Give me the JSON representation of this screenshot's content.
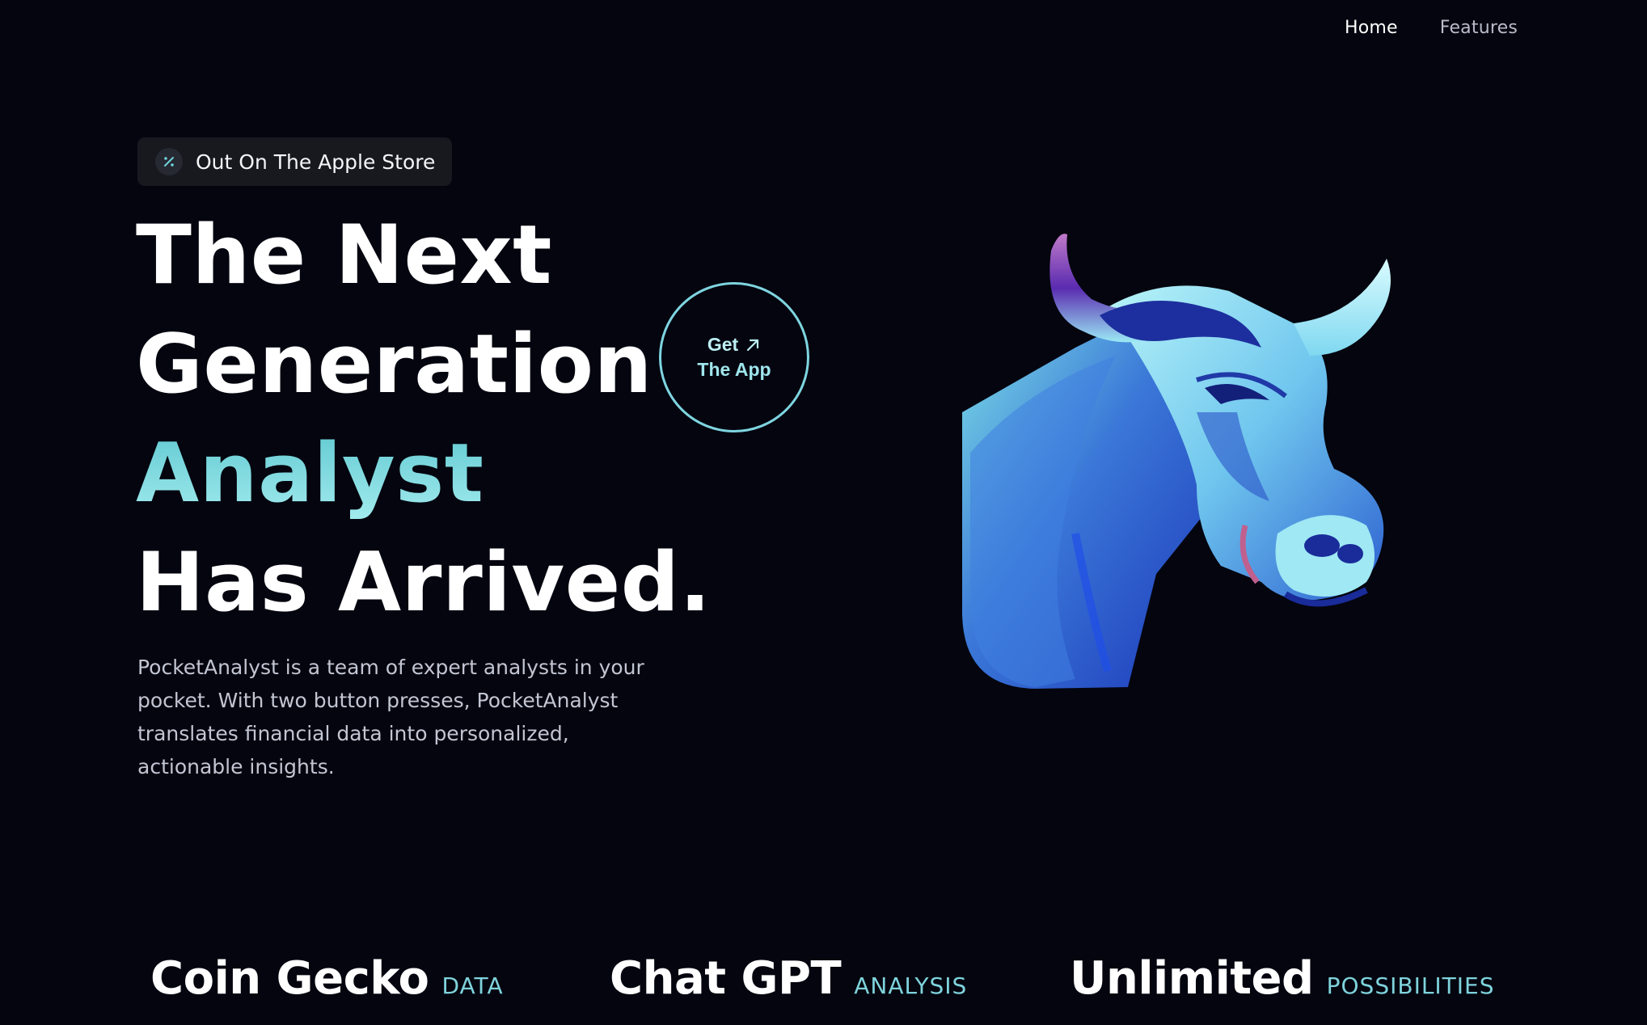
{
  "nav": {
    "home": "Home",
    "features": "Features"
  },
  "badge": {
    "icon": "percent-icon",
    "text": "Out On The Apple Store"
  },
  "hero": {
    "line1": "The Next",
    "line2": "Generation",
    "line3": "Analyst",
    "line4": "Has Arrived.",
    "description": "PocketAnalyst is a team of expert analysts in your pocket. With two button presses, PocketAnalyst translates financial data into personalized, actionable insights."
  },
  "cta": {
    "line1": "Get",
    "line2": "The App",
    "icon": "arrow-up-right-icon"
  },
  "illustration": {
    "icon": "bull-illustration"
  },
  "features": [
    {
      "title": "Coin Gecko",
      "tag": "DATA"
    },
    {
      "title": "Chat GPT",
      "tag": "ANALYSIS"
    },
    {
      "title": "Unlimited",
      "tag": "POSSIBILITIES"
    }
  ],
  "colors": {
    "background": "#04050f",
    "accent": "#7ed5e0",
    "badge_bg": "#18191f"
  }
}
